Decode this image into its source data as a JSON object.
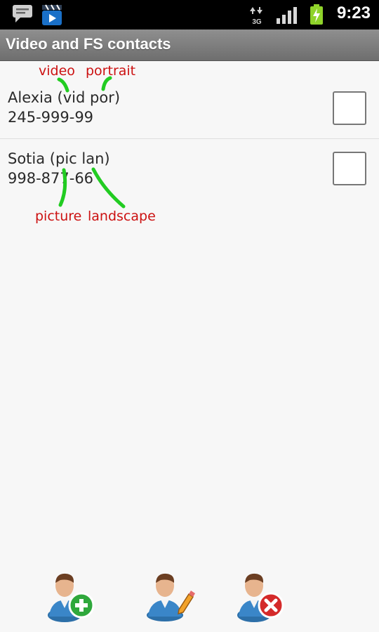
{
  "status_bar": {
    "time": "9:23",
    "network": "3G",
    "icons": [
      "message-icon",
      "video-app-icon",
      "3g-signal-icon",
      "signal-bars-icon",
      "battery-charging-icon"
    ]
  },
  "title_bar": {
    "title": "Video and FS contacts"
  },
  "contacts": [
    {
      "name": "Alexia (vid por)",
      "phone": "245-999-99",
      "checked": false
    },
    {
      "name": "Sotia (pic lan)",
      "phone": "998-877-66",
      "checked": false
    }
  ],
  "annotations": {
    "video": "video",
    "portrait": "portrait",
    "picture": "picture",
    "landscape": "landscape",
    "color": "#cc1111",
    "stroke_color": "#22cc22"
  },
  "toolbar": [
    {
      "name": "add-contact-button",
      "icon": "add-contact-icon"
    },
    {
      "name": "edit-contact-button",
      "icon": "edit-contact-icon"
    },
    {
      "name": "delete-contact-button",
      "icon": "delete-contact-icon"
    }
  ]
}
